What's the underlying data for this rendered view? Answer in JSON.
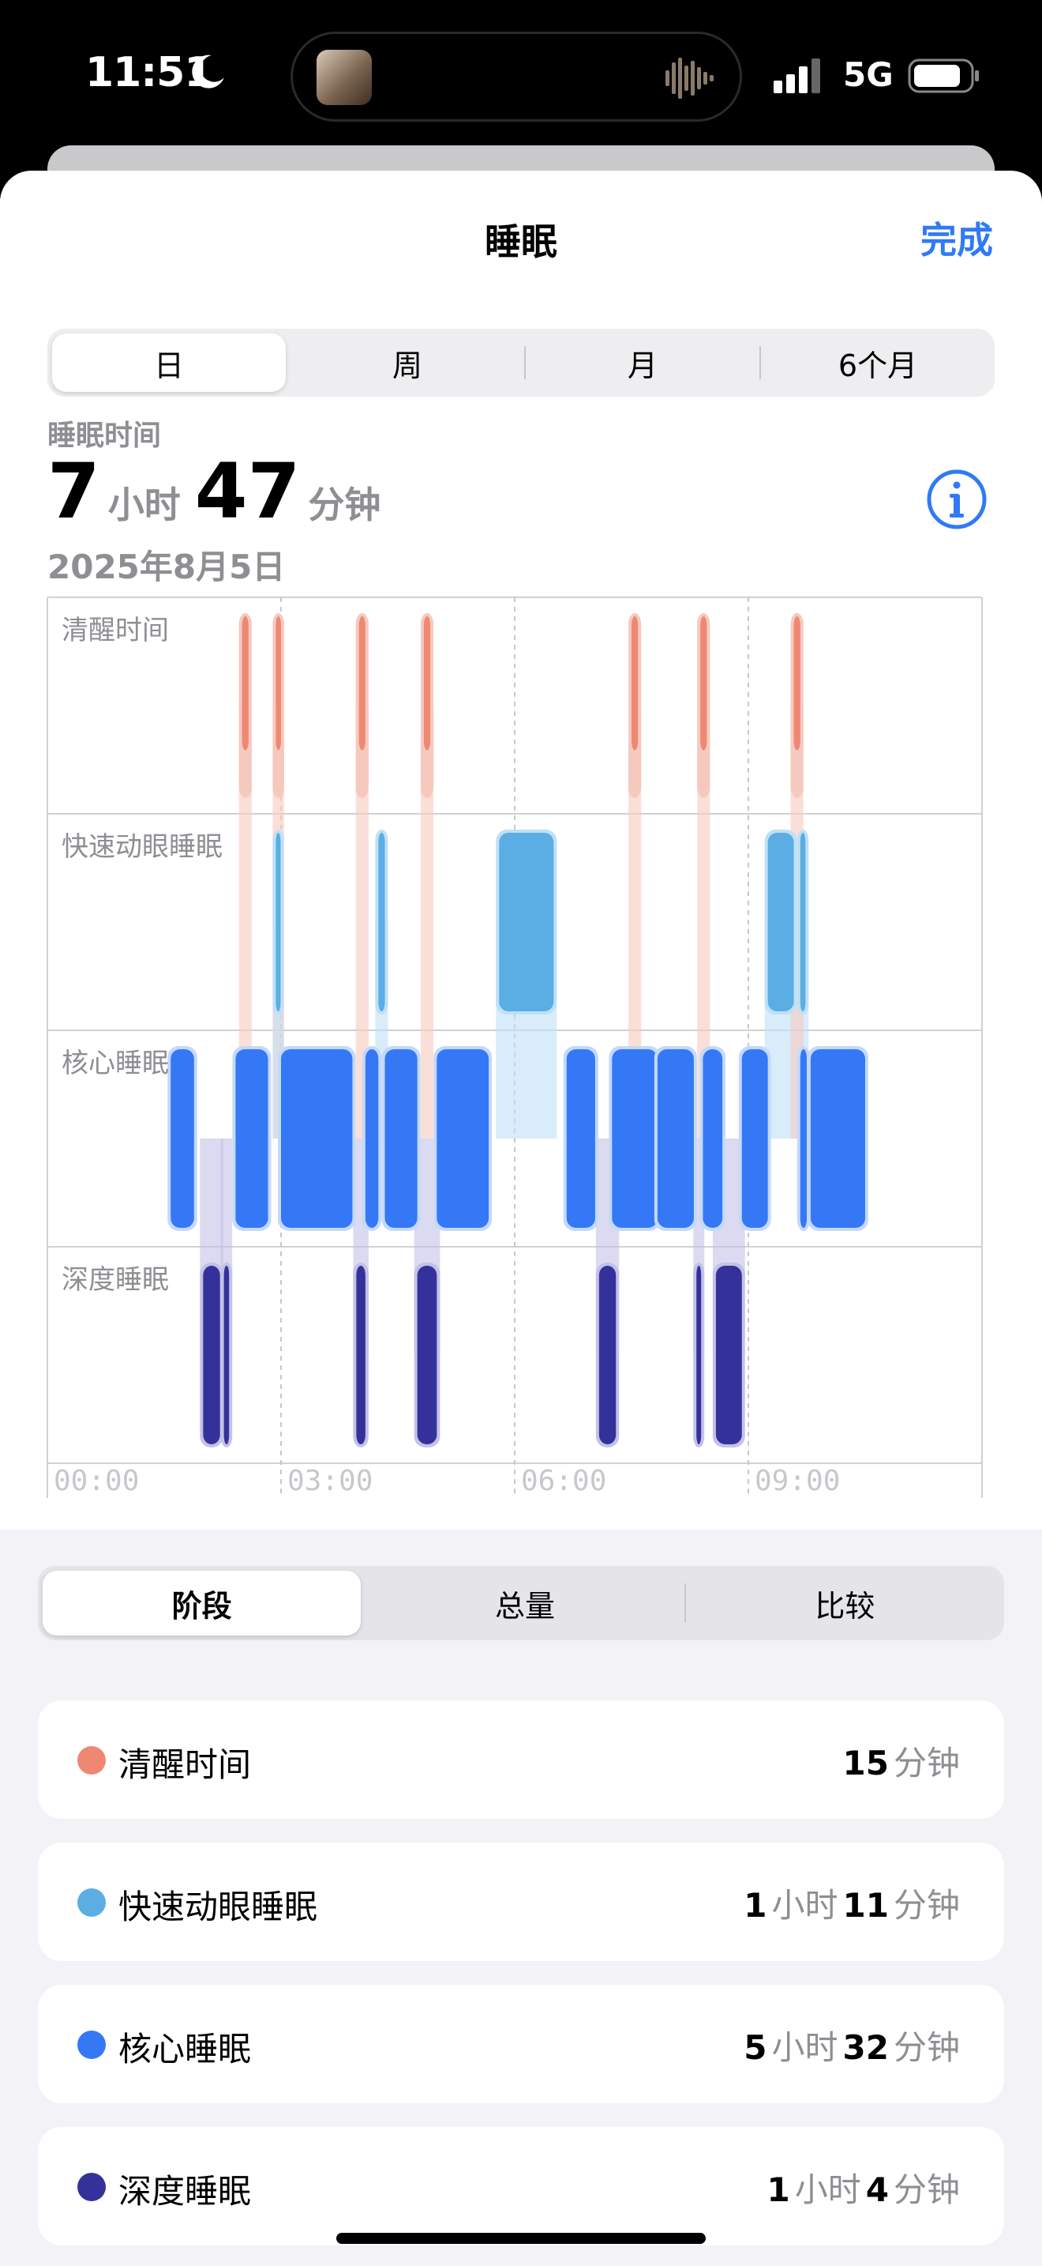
{
  "status": {
    "time": "11:51",
    "network": "5G"
  },
  "nav": {
    "title": "睡眠",
    "done": "完成"
  },
  "range_tabs": [
    "日",
    "周",
    "月",
    "6个月"
  ],
  "summary": {
    "label": "睡眠时间",
    "hours": "7",
    "hours_unit": "小时",
    "minutes": "47",
    "minutes_unit": "分钟",
    "date": "2025年8月5日"
  },
  "chart_data": {
    "type": "sleep-stages",
    "stages": [
      "清醒时间",
      "快速动眼睡眠",
      "核心睡眠",
      "深度睡眠"
    ],
    "x_ticks": [
      "00:00",
      "03:00",
      "06:00",
      "09:00"
    ],
    "segments": [
      {
        "stage": "核心睡眠",
        "start": "01:35",
        "end": "01:53"
      },
      {
        "stage": "深度睡眠",
        "start": "02:00",
        "end": "02:13"
      },
      {
        "stage": "深度睡眠",
        "start": "02:16",
        "end": "02:20"
      },
      {
        "stage": "清醒时间",
        "start": "02:30",
        "end": "02:35"
      },
      {
        "stage": "核心睡眠",
        "start": "02:25",
        "end": "02:50"
      },
      {
        "stage": "清醒时间",
        "start": "02:56",
        "end": "03:00"
      },
      {
        "stage": "快速动眼睡眠",
        "start": "02:56",
        "end": "02:58"
      },
      {
        "stage": "核心睡眠",
        "start": "03:00",
        "end": "03:55"
      },
      {
        "stage": "深度睡眠",
        "start": "03:58",
        "end": "04:05"
      },
      {
        "stage": "清醒时间",
        "start": "04:00",
        "end": "04:05"
      },
      {
        "stage": "核心睡眠",
        "start": "04:05",
        "end": "04:15"
      },
      {
        "stage": "快速动眼睡眠",
        "start": "04:15",
        "end": "04:20"
      },
      {
        "stage": "核心睡眠",
        "start": "04:20",
        "end": "04:45"
      },
      {
        "stage": "深度睡眠",
        "start": "04:45",
        "end": "05:00"
      },
      {
        "stage": "清醒时间",
        "start": "04:50",
        "end": "04:55"
      },
      {
        "stage": "核心睡眠",
        "start": "05:00",
        "end": "05:40"
      },
      {
        "stage": "快速动眼睡眠",
        "start": "05:48",
        "end": "06:30"
      },
      {
        "stage": "核心睡眠",
        "start": "06:40",
        "end": "07:02"
      },
      {
        "stage": "深度睡眠",
        "start": "07:05",
        "end": "07:18"
      },
      {
        "stage": "核心睡眠",
        "start": "07:15",
        "end": "07:50"
      },
      {
        "stage": "清醒时间",
        "start": "07:30",
        "end": "07:35"
      },
      {
        "stage": "核心睡眠",
        "start": "07:50",
        "end": "08:18"
      },
      {
        "stage": "深度睡眠",
        "start": "08:20",
        "end": "08:23"
      },
      {
        "stage": "清醒时间",
        "start": "08:23",
        "end": "08:28"
      },
      {
        "stage": "核心睡眠",
        "start": "08:25",
        "end": "08:40"
      },
      {
        "stage": "深度睡眠",
        "start": "08:35",
        "end": "08:55"
      },
      {
        "stage": "核心睡眠",
        "start": "08:55",
        "end": "09:15"
      },
      {
        "stage": "快速动眼睡眠",
        "start": "09:15",
        "end": "09:35"
      },
      {
        "stage": "快速动眼睡眠",
        "start": "09:40",
        "end": "09:44"
      },
      {
        "stage": "清醒时间",
        "start": "09:35",
        "end": "09:40"
      },
      {
        "stage": "核心睡眠",
        "start": "09:40",
        "end": "09:45"
      },
      {
        "stage": "核心睡眠",
        "start": "09:48",
        "end": "10:30"
      }
    ]
  },
  "view_tabs": [
    "阶段",
    "总量",
    "比较"
  ],
  "stage_totals": [
    {
      "name": "清醒时间",
      "color": "#ef8873",
      "h": "",
      "h_unit": "",
      "m": "15",
      "m_unit": "分钟"
    },
    {
      "name": "快速动眼睡眠",
      "color": "#5aaee3",
      "h": "1",
      "h_unit": "小时",
      "m": "11",
      "m_unit": "分钟"
    },
    {
      "name": "核心睡眠",
      "color": "#3478f6",
      "h": "5",
      "h_unit": "小时",
      "m": "32",
      "m_unit": "分钟"
    },
    {
      "name": "深度睡眠",
      "color": "#35319b",
      "h": "1",
      "h_unit": "小时",
      "m": "4",
      "m_unit": "分钟"
    }
  ]
}
